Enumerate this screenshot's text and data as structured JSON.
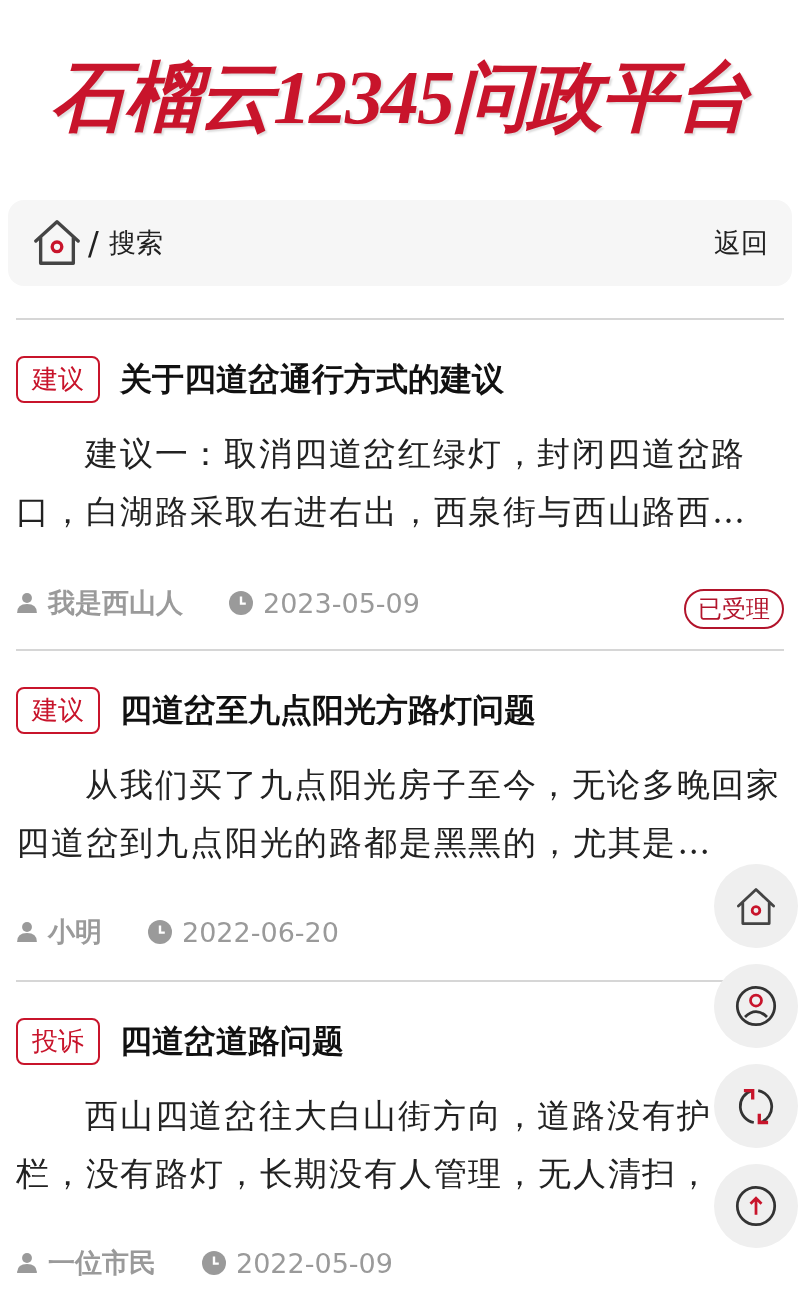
{
  "logo": {
    "text": "石榴云12345问政平台"
  },
  "breadcrumb": {
    "separator": "/",
    "current": "搜索",
    "back": "返回"
  },
  "posts": [
    {
      "category": "建议",
      "title": "关于四道岔通行方式的建议",
      "excerpt": "建议一：取消四道岔红绿灯，封闭四道岔路口，白湖路采取右进右出，西泉街与西山路西…",
      "author": "我是西山人",
      "date": "2023-05-09",
      "status": "已受理"
    },
    {
      "category": "建议",
      "title": "四道岔至九点阳光方路灯问题",
      "excerpt": "从我们买了九点阳光房子至今，无论多晚回家四道岔到九点阳光的路都是黑黑的，尤其是…",
      "author": "小明",
      "date": "2022-06-20"
    },
    {
      "category": "投诉",
      "title": "四道岔道路问题",
      "excerpt": "西山四道岔往大白山街方向，道路没有护栏，没有路灯，长期没有人管理，无人清扫，",
      "author": "一位市民",
      "date": "2022-05-09"
    }
  ],
  "floating_buttons": [
    {
      "kind": "home"
    },
    {
      "kind": "user"
    },
    {
      "kind": "refresh"
    },
    {
      "kind": "top"
    }
  ]
}
